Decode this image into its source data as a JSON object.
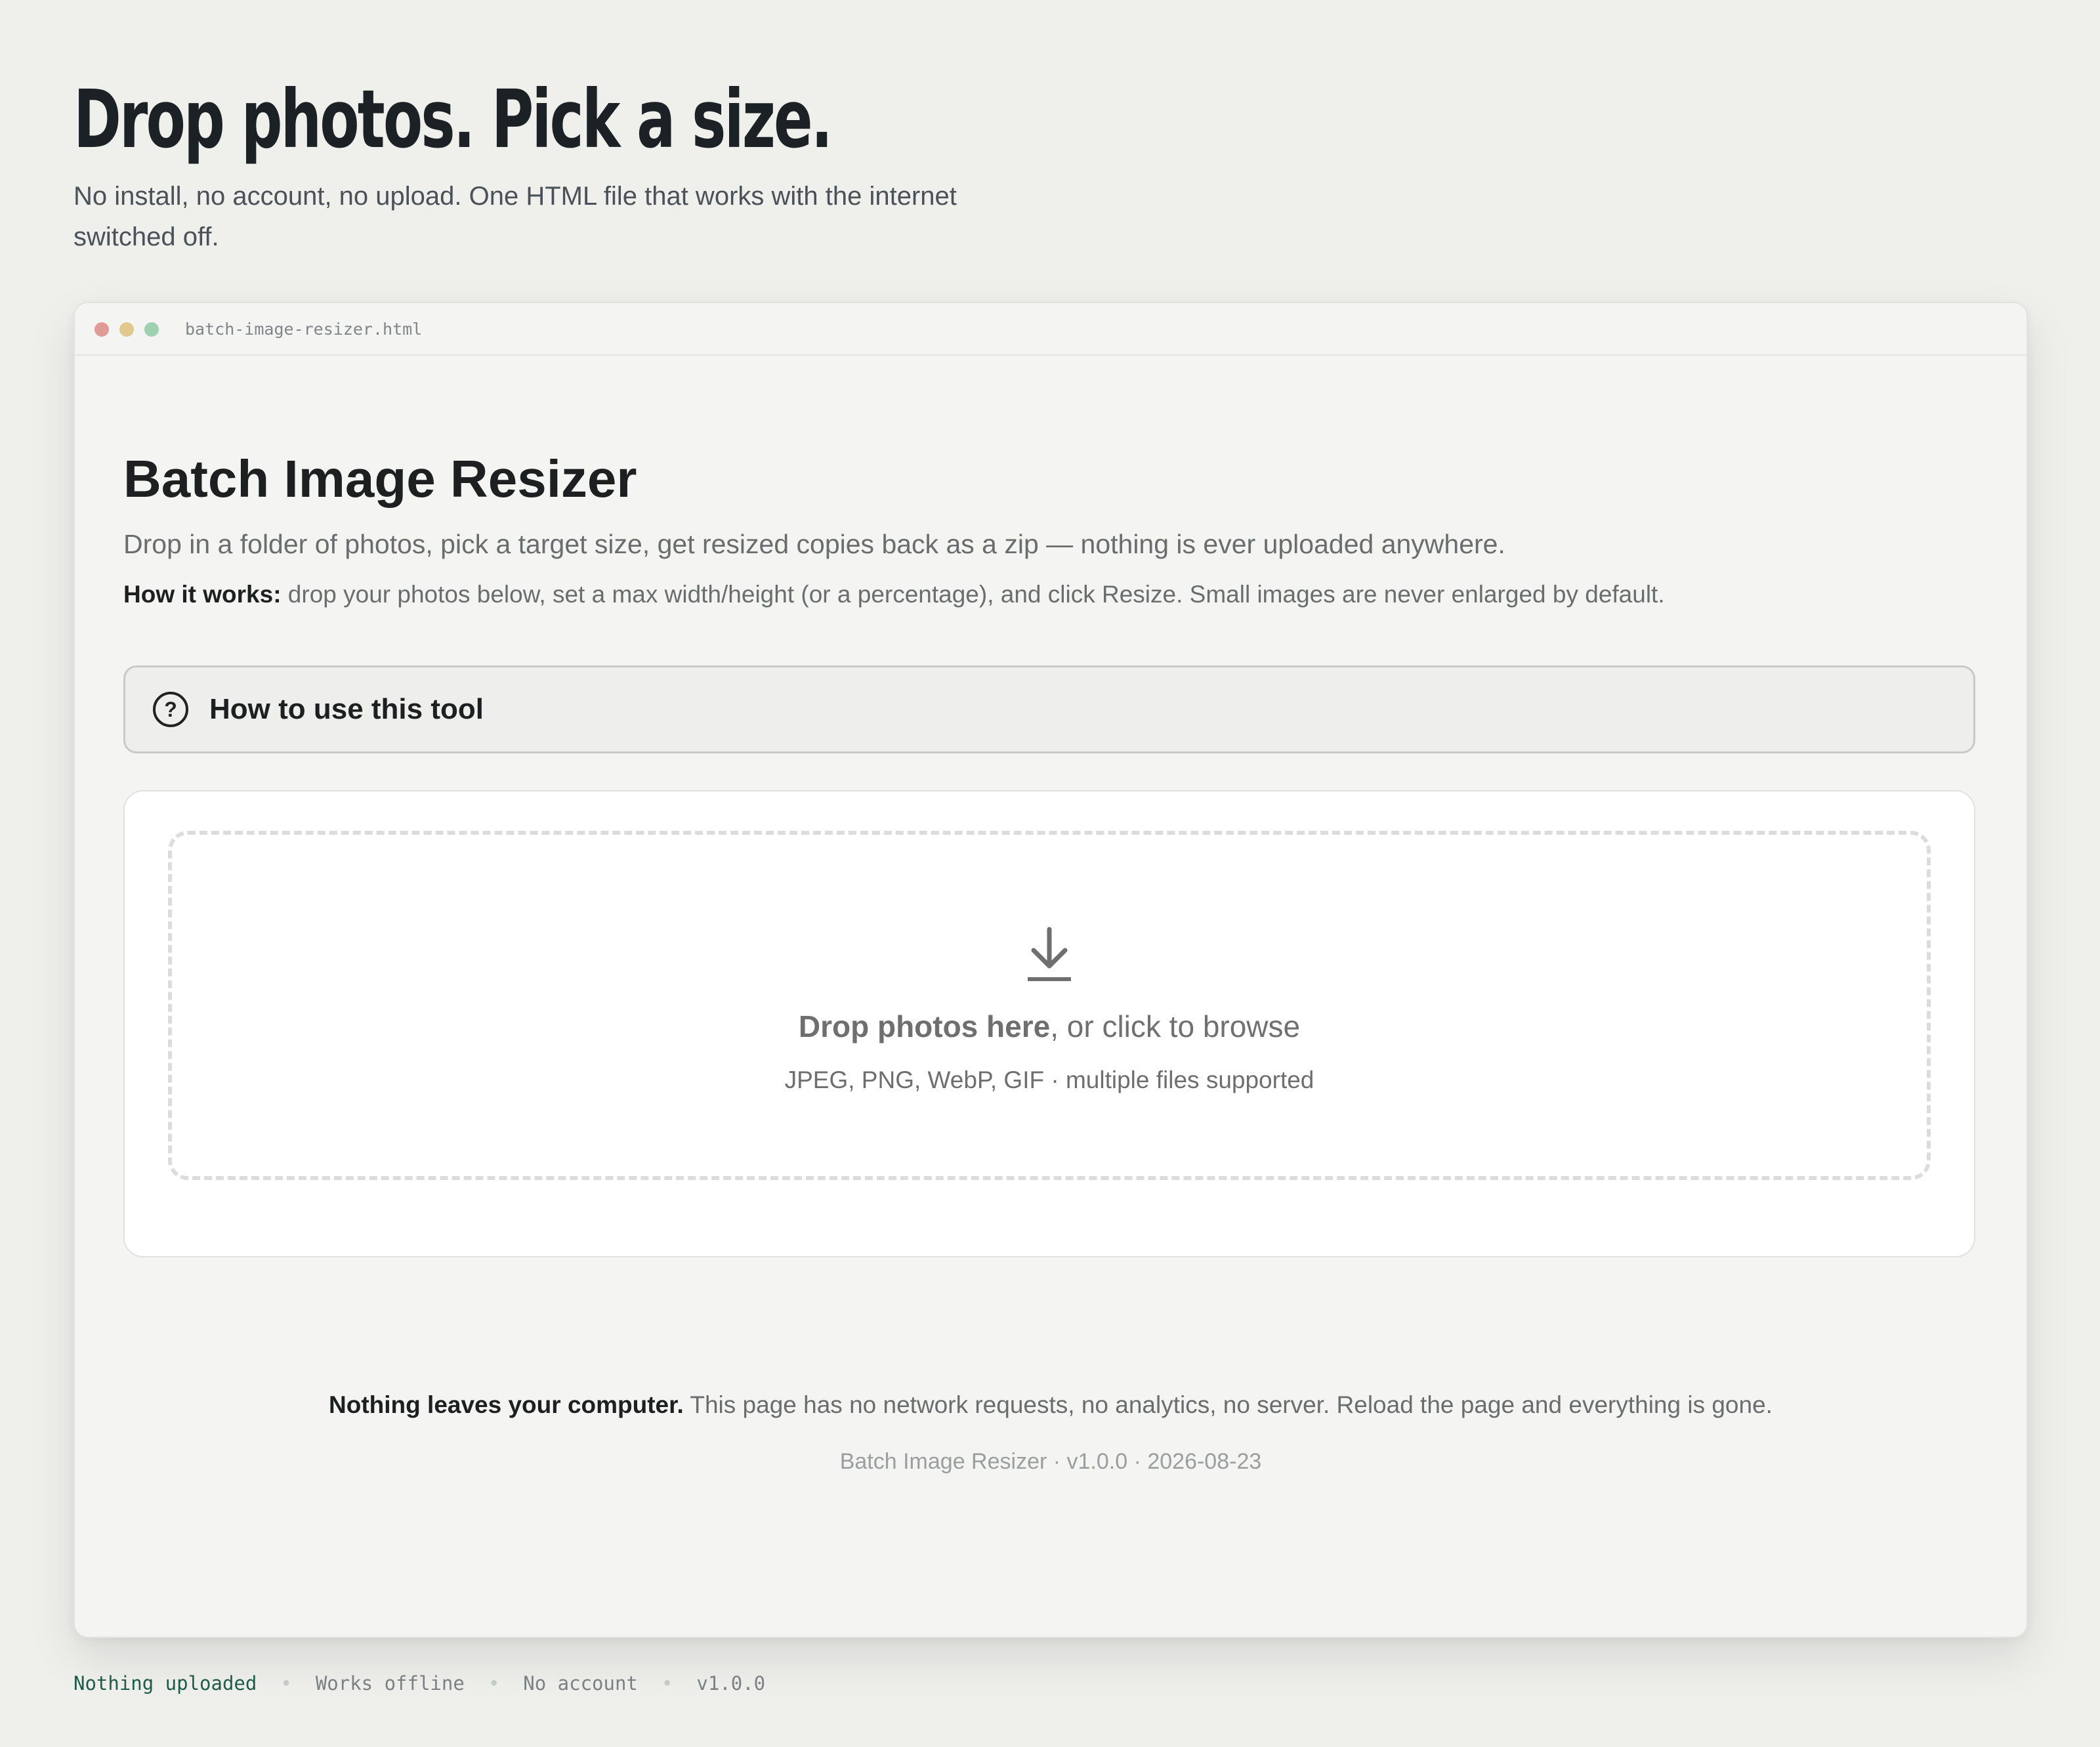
{
  "hero": {
    "title": "Drop photos. Pick a size.",
    "subtitle": "No install, no account, no upload. One HTML file that works with the internet switched off."
  },
  "window": {
    "filename": "batch-image-resizer.html"
  },
  "app": {
    "title": "Batch Image Resizer",
    "description": "Drop in a folder of photos, pick a target size, get resized copies back as a zip — nothing is ever uploaded anywhere.",
    "how_label": "How it works:",
    "how_text": " drop your photos below, set a max width/height (or a percentage), and click Resize. Small images are never enlarged by default."
  },
  "help": {
    "icon": "question-circle-icon",
    "label": "How to use this tool"
  },
  "dropzone": {
    "icon": "download-arrow-icon",
    "main_bold": "Drop photos here",
    "main_rest": ", or click to browse",
    "sub": "JPEG, PNG, WebP, GIF · multiple files supported"
  },
  "footer": {
    "privacy_bold": "Nothing leaves your computer.",
    "privacy_text": " This page has no network requests, no analytics, no server. Reload the page and everything is gone.",
    "version_line": "Batch Image Resizer · v1.0.0 · 2026-08-23"
  },
  "statusbar": {
    "items": [
      "Nothing uploaded",
      "Works offline",
      "No account",
      "v1.0.0"
    ],
    "separator": "•",
    "accent_color": "#1f5a4a"
  },
  "colors": {
    "page_background": "#eff0ec",
    "window_background": "#f4f4f2",
    "traffic_red": "#e19b97",
    "traffic_yellow": "#e1c98d",
    "traffic_green": "#9fd0b0"
  }
}
